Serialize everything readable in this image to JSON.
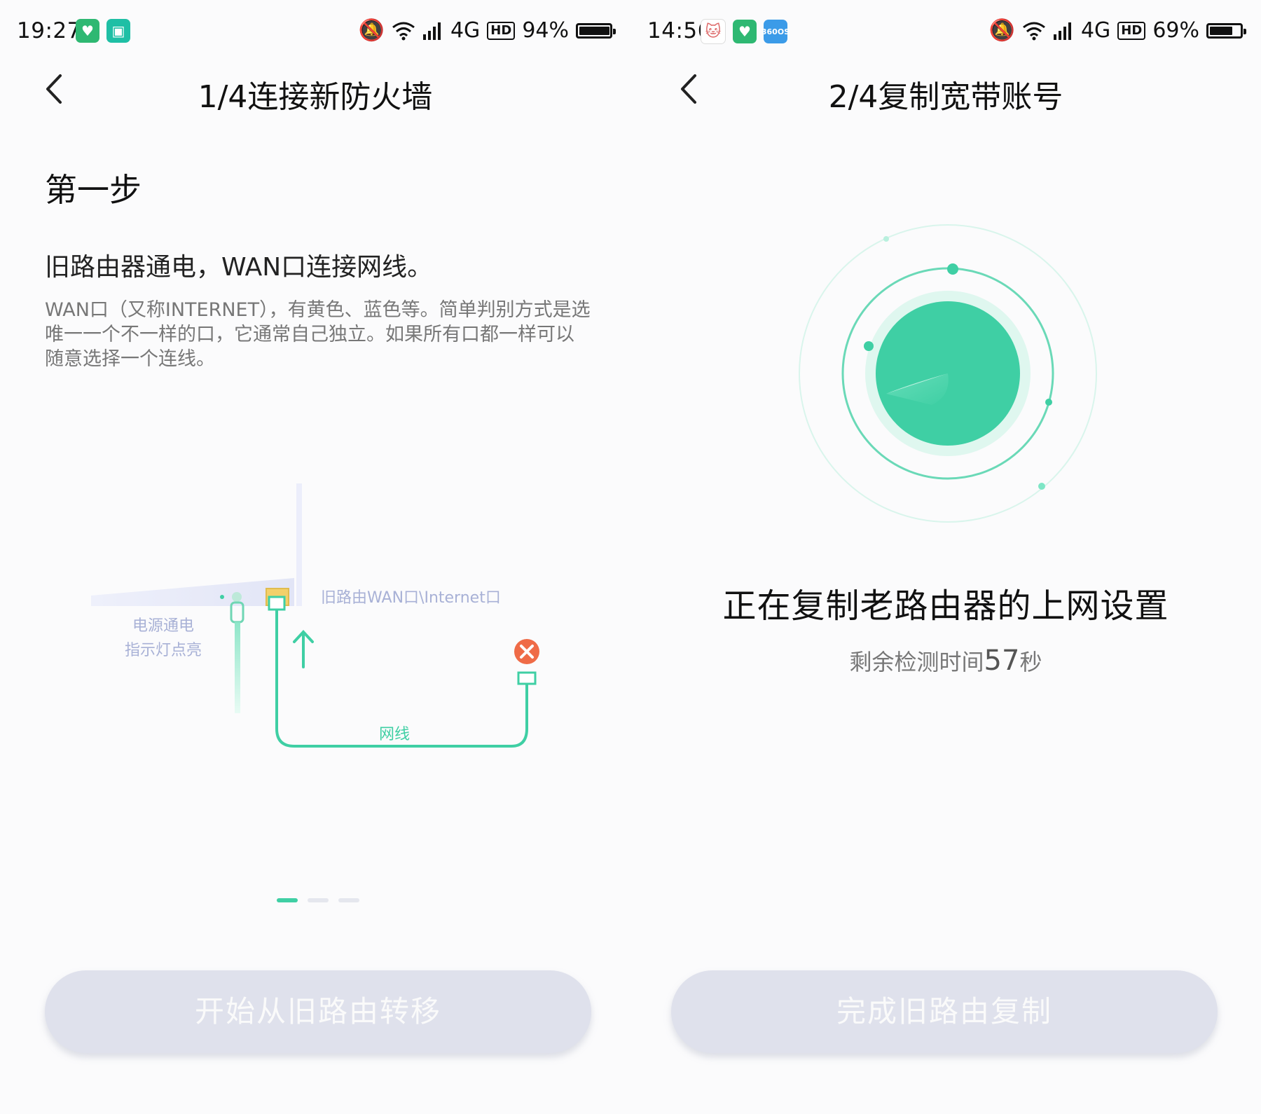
{
  "left": {
    "status": {
      "time": "19:27",
      "network": "4G",
      "hd": "HD",
      "battery": "94%",
      "battery_level": 0.94
    },
    "nav": {
      "title": "1/4连接新防火墙"
    },
    "step_title": "第一步",
    "subtitle": "旧路由器通电，WAN口连接网线。",
    "description": "WAN口（又称INTERNET），有黄色、蓝色等。简单判别方式是选唯一一个不一样的口，它通常自己独立。如果所有口都一样可以随意选择一个连线。",
    "diagram": {
      "power_label_line1": "电源通电",
      "power_label_line2": "指示灯点亮",
      "wan_label": "旧路由WAN口\\Internet口",
      "cable_label": "网线"
    },
    "pager": {
      "total": 3,
      "active": 1
    },
    "button": "开始从旧路由转移"
  },
  "right": {
    "status": {
      "time": "14:56",
      "network": "4G",
      "hd": "HD",
      "battery": "69%",
      "battery_level": 0.69,
      "os_badge_line1": "360",
      "os_badge_line2": "OS"
    },
    "nav": {
      "title": "2/4复制宽带账号"
    },
    "copy_status": "正在复制老路由器的上网设置",
    "timer_prefix": "剩余检测时间",
    "timer_value": "57",
    "timer_unit": "秒",
    "button": "完成旧路由复制"
  },
  "colors": {
    "accent": "#3fcfa4",
    "error": "#ef6b47",
    "button_disabled": "#dfe1ec"
  }
}
